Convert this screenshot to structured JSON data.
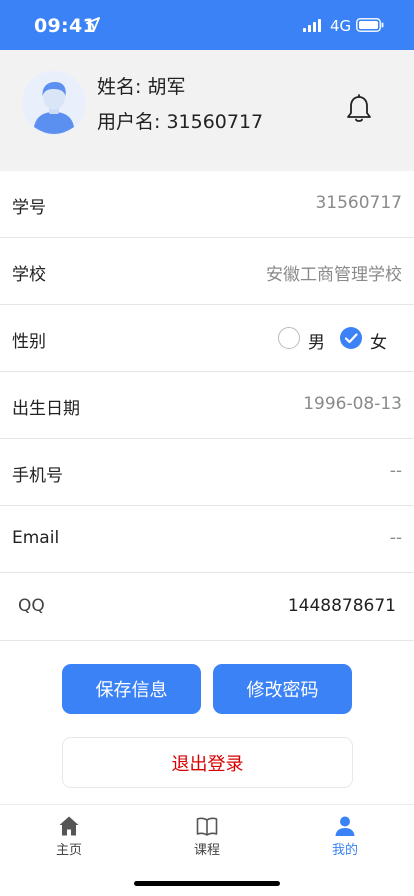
{
  "status_bar": {
    "time": "09:41",
    "network": "4G",
    "background_color": "#3b82f6",
    "icons": [
      "location-arrow-icon",
      "signal-icon",
      "battery-icon"
    ]
  },
  "profile": {
    "name_line": "姓名: 胡军",
    "username_line": "用户名: 31560717",
    "avatar_icon": "avatar-icon",
    "notification_icon": "bell-icon"
  },
  "info": {
    "student_id": {
      "label": "学号",
      "value": "31560717"
    },
    "school": {
      "label": "学校",
      "value": "安徽工商管理学校"
    },
    "gender": {
      "label": "性别",
      "options": [
        {
          "label": "男",
          "checked": false
        },
        {
          "label": "女",
          "checked": true
        }
      ]
    },
    "birthday": {
      "label": "出生日期",
      "value": "1996-08-13"
    },
    "phone": {
      "label": "手机号",
      "value": "--"
    },
    "email": {
      "label": "Email",
      "value": "--"
    },
    "qq": {
      "label": "QQ",
      "value": "1448878671"
    }
  },
  "actions": {
    "save_label": "保存信息",
    "change_password_label": "修改密码",
    "logout_label": "退出登录"
  },
  "tab_bar": {
    "tabs": [
      {
        "label": "主页",
        "icon": "home-icon",
        "active": false
      },
      {
        "label": "课程",
        "icon": "book-icon",
        "active": false
      },
      {
        "label": "我的",
        "icon": "user-icon",
        "active": true
      }
    ]
  },
  "colors": {
    "accent": "#3b82f6",
    "logout_text": "#d80000",
    "profile_background": "#f2f2f2"
  }
}
